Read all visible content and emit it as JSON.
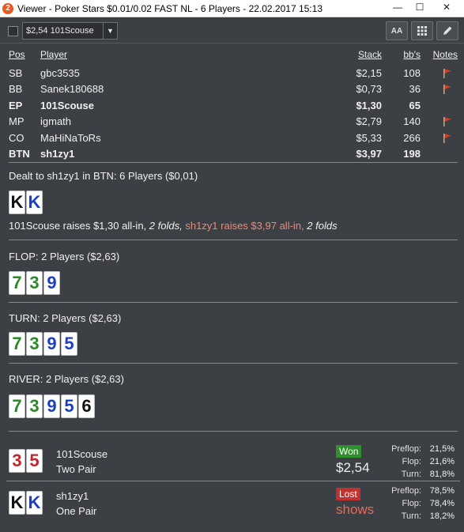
{
  "window": {
    "app_icon": "2",
    "title": "Viewer - Poker Stars $0.01/0.02 FAST NL - 6 Players - 22.02.2017 15:13",
    "minimize": "—",
    "maximize": "☐",
    "close": "✕"
  },
  "toolbar": {
    "hand_select_value": "$2,54 101Scouse",
    "font_size_label": "AA",
    "grid_icon": "grid-icon",
    "edit_icon": "pencil-icon"
  },
  "table_header": {
    "pos": "Pos",
    "player": "Player",
    "stack": "Stack",
    "bbs": "bb's",
    "notes": "Notes"
  },
  "players": [
    {
      "pos": "SB",
      "name": "gbc3535",
      "stack": "$2,15",
      "bbs": "108",
      "flag": true,
      "bold": false
    },
    {
      "pos": "BB",
      "name": "Sanek180688",
      "stack": "$0,73",
      "bbs": "36",
      "flag": true,
      "bold": false
    },
    {
      "pos": "EP",
      "name": "101Scouse",
      "stack": "$1,30",
      "bbs": "65",
      "flag": false,
      "bold": true
    },
    {
      "pos": "MP",
      "name": "igmath",
      "stack": "$2,79",
      "bbs": "140",
      "flag": true,
      "bold": false
    },
    {
      "pos": "CO",
      "name": "MaHiNaToRs",
      "stack": "$5,33",
      "bbs": "266",
      "flag": true,
      "bold": false
    },
    {
      "pos": "BTN",
      "name": "sh1zy1",
      "stack": "$3,97",
      "bbs": "198",
      "flag": false,
      "bold": true
    }
  ],
  "preflop": {
    "title": "Dealt to sh1zy1 in BTN: 6 Players ($0,01)",
    "cards": [
      {
        "rank": "K",
        "suit": "spade"
      },
      {
        "rank": "K",
        "suit": "diamond"
      }
    ],
    "action": {
      "a1": "101Scouse raises $1,30 all-in,",
      "a2": "2 folds,",
      "a3": "sh1zy1 raises $3,97 all-in,",
      "a4": "2 folds"
    }
  },
  "flop": {
    "title": "FLOP: 2 Players ($2,63)",
    "cards": [
      {
        "rank": "7",
        "suit": "club"
      },
      {
        "rank": "3",
        "suit": "club"
      },
      {
        "rank": "9",
        "suit": "diamond"
      }
    ]
  },
  "turn": {
    "title": "TURN: 2 Players ($2,63)",
    "cards": [
      {
        "rank": "7",
        "suit": "club"
      },
      {
        "rank": "3",
        "suit": "club"
      },
      {
        "rank": "9",
        "suit": "diamond"
      },
      {
        "rank": "5",
        "suit": "diamond"
      }
    ]
  },
  "river": {
    "title": "RIVER: 2 Players ($2,63)",
    "cards": [
      {
        "rank": "7",
        "suit": "club"
      },
      {
        "rank": "3",
        "suit": "club"
      },
      {
        "rank": "9",
        "suit": "diamond"
      },
      {
        "rank": "5",
        "suit": "diamond"
      },
      {
        "rank": "6",
        "suit": "spade"
      }
    ]
  },
  "results": [
    {
      "name": "101Scouse",
      "hand": "Two Pair",
      "cards": [
        {
          "rank": "3",
          "suit": "heart"
        },
        {
          "rank": "5",
          "suit": "heart"
        }
      ],
      "badge": "Won",
      "badge_type": "won",
      "amount": "$2,54",
      "stats": [
        {
          "label": "Preflop:",
          "value": "21,5%"
        },
        {
          "label": "Flop:",
          "value": "21,6%"
        },
        {
          "label": "Turn:",
          "value": "81,8%"
        }
      ]
    },
    {
      "name": "sh1zy1",
      "hand": "One Pair",
      "cards": [
        {
          "rank": "K",
          "suit": "spade"
        },
        {
          "rank": "K",
          "suit": "diamond"
        }
      ],
      "badge": "Lost",
      "badge_type": "lost",
      "amount": "shows",
      "stats": [
        {
          "label": "Preflop:",
          "value": "78,5%"
        },
        {
          "label": "Flop:",
          "value": "78,4%"
        },
        {
          "label": "Turn:",
          "value": "18,2%"
        }
      ]
    }
  ],
  "colors": {
    "background": "#3c3f43",
    "won": "#2f8f2f",
    "lost": "#c23030",
    "hero_action": "#e88a7a",
    "flag": "#d93b2b"
  }
}
